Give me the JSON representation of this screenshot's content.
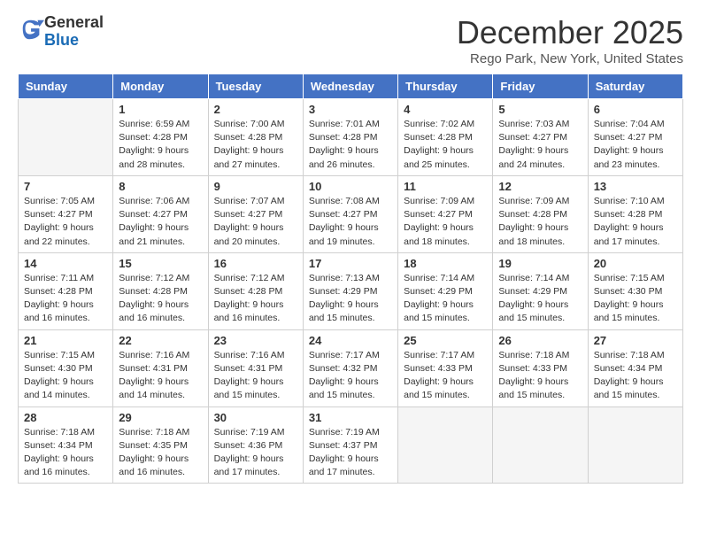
{
  "header": {
    "logo_line1": "General",
    "logo_line2": "Blue",
    "month_title": "December 2025",
    "location": "Rego Park, New York, United States"
  },
  "days_of_week": [
    "Sunday",
    "Monday",
    "Tuesday",
    "Wednesday",
    "Thursday",
    "Friday",
    "Saturday"
  ],
  "weeks": [
    [
      {
        "num": "",
        "empty": true
      },
      {
        "num": "1",
        "sunrise": "Sunrise: 6:59 AM",
        "sunset": "Sunset: 4:28 PM",
        "daylight": "Daylight: 9 hours and 28 minutes."
      },
      {
        "num": "2",
        "sunrise": "Sunrise: 7:00 AM",
        "sunset": "Sunset: 4:28 PM",
        "daylight": "Daylight: 9 hours and 27 minutes."
      },
      {
        "num": "3",
        "sunrise": "Sunrise: 7:01 AM",
        "sunset": "Sunset: 4:28 PM",
        "daylight": "Daylight: 9 hours and 26 minutes."
      },
      {
        "num": "4",
        "sunrise": "Sunrise: 7:02 AM",
        "sunset": "Sunset: 4:28 PM",
        "daylight": "Daylight: 9 hours and 25 minutes."
      },
      {
        "num": "5",
        "sunrise": "Sunrise: 7:03 AM",
        "sunset": "Sunset: 4:27 PM",
        "daylight": "Daylight: 9 hours and 24 minutes."
      },
      {
        "num": "6",
        "sunrise": "Sunrise: 7:04 AM",
        "sunset": "Sunset: 4:27 PM",
        "daylight": "Daylight: 9 hours and 23 minutes."
      }
    ],
    [
      {
        "num": "7",
        "sunrise": "Sunrise: 7:05 AM",
        "sunset": "Sunset: 4:27 PM",
        "daylight": "Daylight: 9 hours and 22 minutes."
      },
      {
        "num": "8",
        "sunrise": "Sunrise: 7:06 AM",
        "sunset": "Sunset: 4:27 PM",
        "daylight": "Daylight: 9 hours and 21 minutes."
      },
      {
        "num": "9",
        "sunrise": "Sunrise: 7:07 AM",
        "sunset": "Sunset: 4:27 PM",
        "daylight": "Daylight: 9 hours and 20 minutes."
      },
      {
        "num": "10",
        "sunrise": "Sunrise: 7:08 AM",
        "sunset": "Sunset: 4:27 PM",
        "daylight": "Daylight: 9 hours and 19 minutes."
      },
      {
        "num": "11",
        "sunrise": "Sunrise: 7:09 AM",
        "sunset": "Sunset: 4:27 PM",
        "daylight": "Daylight: 9 hours and 18 minutes."
      },
      {
        "num": "12",
        "sunrise": "Sunrise: 7:09 AM",
        "sunset": "Sunset: 4:28 PM",
        "daylight": "Daylight: 9 hours and 18 minutes."
      },
      {
        "num": "13",
        "sunrise": "Sunrise: 7:10 AM",
        "sunset": "Sunset: 4:28 PM",
        "daylight": "Daylight: 9 hours and 17 minutes."
      }
    ],
    [
      {
        "num": "14",
        "sunrise": "Sunrise: 7:11 AM",
        "sunset": "Sunset: 4:28 PM",
        "daylight": "Daylight: 9 hours and 16 minutes."
      },
      {
        "num": "15",
        "sunrise": "Sunrise: 7:12 AM",
        "sunset": "Sunset: 4:28 PM",
        "daylight": "Daylight: 9 hours and 16 minutes."
      },
      {
        "num": "16",
        "sunrise": "Sunrise: 7:12 AM",
        "sunset": "Sunset: 4:28 PM",
        "daylight": "Daylight: 9 hours and 16 minutes."
      },
      {
        "num": "17",
        "sunrise": "Sunrise: 7:13 AM",
        "sunset": "Sunset: 4:29 PM",
        "daylight": "Daylight: 9 hours and 15 minutes."
      },
      {
        "num": "18",
        "sunrise": "Sunrise: 7:14 AM",
        "sunset": "Sunset: 4:29 PM",
        "daylight": "Daylight: 9 hours and 15 minutes."
      },
      {
        "num": "19",
        "sunrise": "Sunrise: 7:14 AM",
        "sunset": "Sunset: 4:29 PM",
        "daylight": "Daylight: 9 hours and 15 minutes."
      },
      {
        "num": "20",
        "sunrise": "Sunrise: 7:15 AM",
        "sunset": "Sunset: 4:30 PM",
        "daylight": "Daylight: 9 hours and 15 minutes."
      }
    ],
    [
      {
        "num": "21",
        "sunrise": "Sunrise: 7:15 AM",
        "sunset": "Sunset: 4:30 PM",
        "daylight": "Daylight: 9 hours and 14 minutes."
      },
      {
        "num": "22",
        "sunrise": "Sunrise: 7:16 AM",
        "sunset": "Sunset: 4:31 PM",
        "daylight": "Daylight: 9 hours and 14 minutes."
      },
      {
        "num": "23",
        "sunrise": "Sunrise: 7:16 AM",
        "sunset": "Sunset: 4:31 PM",
        "daylight": "Daylight: 9 hours and 15 minutes."
      },
      {
        "num": "24",
        "sunrise": "Sunrise: 7:17 AM",
        "sunset": "Sunset: 4:32 PM",
        "daylight": "Daylight: 9 hours and 15 minutes."
      },
      {
        "num": "25",
        "sunrise": "Sunrise: 7:17 AM",
        "sunset": "Sunset: 4:33 PM",
        "daylight": "Daylight: 9 hours and 15 minutes."
      },
      {
        "num": "26",
        "sunrise": "Sunrise: 7:18 AM",
        "sunset": "Sunset: 4:33 PM",
        "daylight": "Daylight: 9 hours and 15 minutes."
      },
      {
        "num": "27",
        "sunrise": "Sunrise: 7:18 AM",
        "sunset": "Sunset: 4:34 PM",
        "daylight": "Daylight: 9 hours and 15 minutes."
      }
    ],
    [
      {
        "num": "28",
        "sunrise": "Sunrise: 7:18 AM",
        "sunset": "Sunset: 4:34 PM",
        "daylight": "Daylight: 9 hours and 16 minutes."
      },
      {
        "num": "29",
        "sunrise": "Sunrise: 7:18 AM",
        "sunset": "Sunset: 4:35 PM",
        "daylight": "Daylight: 9 hours and 16 minutes."
      },
      {
        "num": "30",
        "sunrise": "Sunrise: 7:19 AM",
        "sunset": "Sunset: 4:36 PM",
        "daylight": "Daylight: 9 hours and 17 minutes."
      },
      {
        "num": "31",
        "sunrise": "Sunrise: 7:19 AM",
        "sunset": "Sunset: 4:37 PM",
        "daylight": "Daylight: 9 hours and 17 minutes."
      },
      {
        "num": "",
        "empty": true
      },
      {
        "num": "",
        "empty": true
      },
      {
        "num": "",
        "empty": true
      }
    ]
  ]
}
